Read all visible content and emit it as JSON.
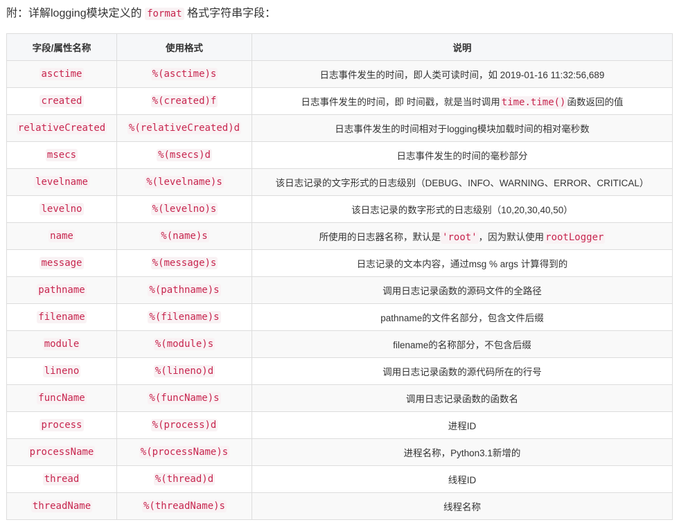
{
  "intro": {
    "prefix": "附：详解logging模块定义的",
    "code": "format",
    "suffix": "格式字符串字段："
  },
  "table": {
    "headers": [
      "字段/属性名称",
      "使用格式",
      "说明"
    ],
    "rows": [
      {
        "field": "asctime",
        "format": "%(asctime)s",
        "desc": [
          {
            "t": "日志事件发生的时间，即人类可读时间，如 2019-01-16 11:32:56,689"
          }
        ]
      },
      {
        "field": "created",
        "format": "%(created)f",
        "desc": [
          {
            "t": "日志事件发生的时间，即 时间戳，就是当时调用"
          },
          {
            "c": "time.time()"
          },
          {
            "t": "函数返回的值"
          }
        ]
      },
      {
        "field": "relativeCreated",
        "format": "%(relativeCreated)d",
        "desc": [
          {
            "t": "日志事件发生的时间相对于logging模块加载时间的相对毫秒数"
          }
        ]
      },
      {
        "field": "msecs",
        "format": "%(msecs)d",
        "desc": [
          {
            "t": "日志事件发生的时间的毫秒部分"
          }
        ]
      },
      {
        "field": "levelname",
        "format": "%(levelname)s",
        "desc": [
          {
            "t": "该日志记录的文字形式的日志级别（DEBUG、INFO、WARNING、ERROR、CRITICAL）"
          }
        ]
      },
      {
        "field": "levelno",
        "format": "%(levelno)s",
        "desc": [
          {
            "t": "该日志记录的数字形式的日志级别（10,20,30,40,50）"
          }
        ]
      },
      {
        "field": "name",
        "format": "%(name)s",
        "desc": [
          {
            "t": "所使用的日志器名称，默认是"
          },
          {
            "c": "'root'"
          },
          {
            "t": "，因为默认使用"
          },
          {
            "c": "rootLogger"
          }
        ]
      },
      {
        "field": "message",
        "format": "%(message)s",
        "desc": [
          {
            "t": "日志记录的文本内容，通过msg % args 计算得到的"
          }
        ]
      },
      {
        "field": "pathname",
        "format": "%(pathname)s",
        "desc": [
          {
            "t": "调用日志记录函数的源码文件的全路径"
          }
        ]
      },
      {
        "field": "filename",
        "format": "%(filename)s",
        "desc": [
          {
            "t": "pathname的文件名部分，包含文件后缀"
          }
        ]
      },
      {
        "field": "module",
        "format": "%(module)s",
        "desc": [
          {
            "t": "filename的名称部分，不包含后缀"
          }
        ]
      },
      {
        "field": "lineno",
        "format": "%(lineno)d",
        "desc": [
          {
            "t": "调用日志记录函数的源代码所在的行号"
          }
        ]
      },
      {
        "field": "funcName",
        "format": "%(funcName)s",
        "desc": [
          {
            "t": "调用日志记录函数的函数名"
          }
        ]
      },
      {
        "field": "process",
        "format": "%(process)d",
        "desc": [
          {
            "t": "进程ID"
          }
        ]
      },
      {
        "field": "processName",
        "format": "%(processName)s",
        "desc": [
          {
            "t": "进程名称，Python3.1新增的"
          }
        ]
      },
      {
        "field": "thread",
        "format": "%(thread)d",
        "desc": [
          {
            "t": "线程ID"
          }
        ]
      },
      {
        "field": "threadName",
        "format": "%(threadName)s",
        "desc": [
          {
            "t": "线程名称"
          }
        ]
      }
    ]
  },
  "colors": {
    "code_text": "#c7254e",
    "code_bg": "#f9f2f4",
    "border": "#dddddd",
    "header_bg": "#f6f7f9",
    "stripe_bg": "#f9f9f9"
  }
}
